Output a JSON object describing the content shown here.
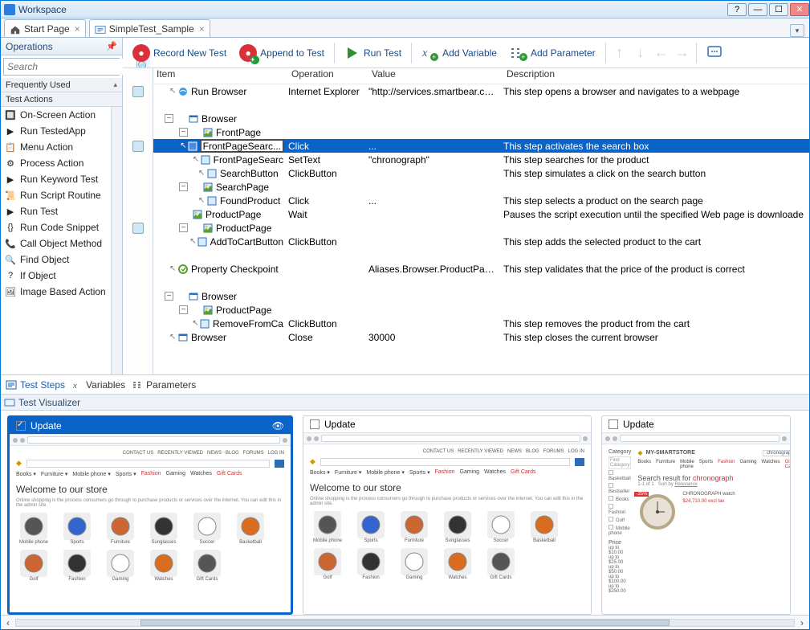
{
  "window": {
    "title": "Workspace"
  },
  "tabs": [
    {
      "label": "Start Page"
    },
    {
      "label": "SimpleTest_Sample"
    }
  ],
  "operations": {
    "title": "Operations",
    "search_placeholder": "Search",
    "section1": "Frequently Used",
    "section2": "Test Actions",
    "items": [
      "On-Screen Action",
      "Run TestedApp",
      "Menu Action",
      "Process Action",
      "Run Keyword Test",
      "Run Script Routine",
      "Run Test",
      "Run Code Snippet",
      "Call Object Method",
      "Find Object",
      "If Object",
      "Image Based Action"
    ]
  },
  "toolbar": {
    "record": "Record New Test",
    "append": "Append to Test",
    "run": "Run Test",
    "addvar": "Add Variable",
    "addpar": "Add Parameter"
  },
  "grid": {
    "headers": {
      "item": "Item",
      "op": "Operation",
      "val": "Value",
      "desc": "Description"
    },
    "rows": [
      {
        "indent": 0,
        "exp": "",
        "icon": "ie",
        "item": "Run Browser",
        "op": "Internet Explorer",
        "val": "\"http://services.smartbear.com/",
        "desc": "This step opens a browser and navigates to a webpage"
      },
      {
        "indent": 0,
        "exp": "-",
        "icon": "win",
        "item": "Browser",
        "op": "",
        "val": "",
        "desc": ""
      },
      {
        "indent": 1,
        "exp": "-",
        "icon": "pg",
        "item": "FrontPage",
        "op": "",
        "val": "",
        "desc": ""
      },
      {
        "indent": 2,
        "exp": "",
        "icon": "obj",
        "item": "FrontPageSearc...",
        "op": "Click",
        "val": "...",
        "desc": "This step activates the search box",
        "sel": true,
        "edit": true
      },
      {
        "indent": 2,
        "exp": "",
        "icon": "obj",
        "item": "FrontPageSearc",
        "op": "SetText",
        "val": "\"chronograph\"",
        "desc": "This step searches for the product"
      },
      {
        "indent": 2,
        "exp": "",
        "icon": "obj",
        "item": "SearchButton",
        "op": "ClickButton",
        "val": "",
        "desc": "This step simulates a click on the search button"
      },
      {
        "indent": 1,
        "exp": "-",
        "icon": "pg",
        "item": "SearchPage",
        "op": "",
        "val": "",
        "desc": ""
      },
      {
        "indent": 2,
        "exp": "",
        "icon": "obj",
        "item": "FoundProduct",
        "op": "Click",
        "val": "...",
        "desc": "This step selects a product on the search page"
      },
      {
        "indent": 1,
        "exp": "",
        "icon": "pg",
        "item": "ProductPage",
        "op": "Wait",
        "val": "",
        "desc": "Pauses the script execution until the specified Web page is downloade"
      },
      {
        "indent": 1,
        "exp": "-",
        "icon": "pg",
        "item": "ProductPage",
        "op": "",
        "val": "",
        "desc": ""
      },
      {
        "indent": 2,
        "exp": "",
        "icon": "obj",
        "item": "AddToCartButton",
        "op": "ClickButton",
        "val": "",
        "desc": "This step adds the selected product to the cart"
      },
      {
        "indent": 0,
        "exp": "",
        "icon": "chk",
        "item": "Property Checkpoint",
        "op": "",
        "val": "Aliases.Browser.ProductPage.C",
        "desc": "This step validates that the price of the product is correct"
      },
      {
        "indent": 0,
        "exp": "-",
        "icon": "win",
        "item": "Browser",
        "op": "",
        "val": "",
        "desc": ""
      },
      {
        "indent": 1,
        "exp": "-",
        "icon": "pg",
        "item": "ProductPage",
        "op": "",
        "val": "",
        "desc": ""
      },
      {
        "indent": 2,
        "exp": "",
        "icon": "obj",
        "item": "RemoveFromCa",
        "op": "ClickButton",
        "val": "",
        "desc": "This step removes the product from the cart"
      },
      {
        "indent": 0,
        "exp": "",
        "icon": "win",
        "item": "Browser",
        "op": "Close",
        "val": "30000",
        "desc": "This step closes the current browser"
      }
    ]
  },
  "bottom_tabs": {
    "steps": "Test Steps",
    "vars": "Variables",
    "params": "Parameters"
  },
  "visualizer": {
    "title": "Test Visualizer",
    "card_label": "Update",
    "store": {
      "welcome": "Welcome to our store",
      "blurb": "Online shopping is the process consumers go through to purchase products or services over the internet. You can edit this in the admin site.",
      "categories": [
        "Books",
        "Furniture",
        "Mobile phone",
        "Sports",
        "Fashion",
        "Gaming",
        "Watches",
        "Gift Cards"
      ],
      "products": [
        "Mobile phone",
        "Sports",
        "Furniture",
        "Sunglasses",
        "Soccer",
        "Basketball"
      ],
      "products2": [
        "Golf",
        "Fashion",
        "Gaming",
        "Watches",
        "Gift Cards"
      ],
      "brand": "MY-SMARTSTORE",
      "search_term": "chronograph",
      "search_title": "Search result for ",
      "side": [
        "Basketball",
        "Bestseller",
        "Books",
        "Fashion",
        "Golf",
        "Mobile phone"
      ],
      "price": "Price",
      "price_ranges": [
        "up to $10.00",
        "up to $25.00",
        "up to $50.00",
        "up to $100.00",
        "up to $250.00"
      ],
      "watch_name": "CHRONOGRAPH watch",
      "watch_price": "$24,710.00 excl tax",
      "top_links": [
        "CONTACT US",
        "RECENTLY VIEWED",
        "NEWS",
        "BLOG",
        "FORUMS",
        "LOG IN"
      ],
      "relevance": "Relevance",
      "category_lbl": "Category",
      "find_cat": "Find Category",
      "sort": "Sort by",
      "count": "1-1 of 1"
    }
  }
}
